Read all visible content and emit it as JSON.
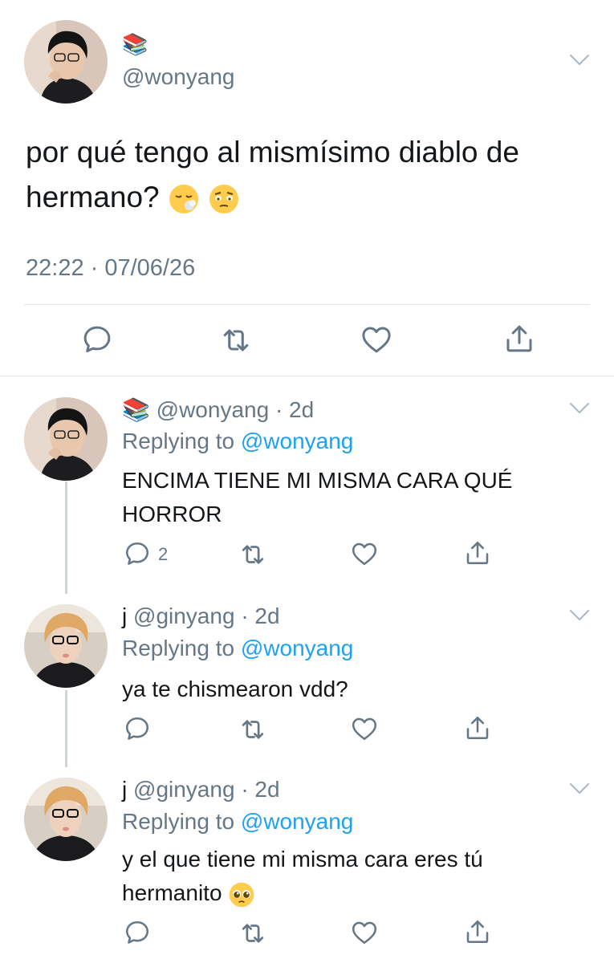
{
  "main_tweet": {
    "name_emoji": "📚",
    "handle": "@wonyang",
    "text": "por qué tengo al mismísimo diablo de hermano?",
    "timestamp": "22:22 · 07/06/26",
    "avatar": "person-avatar"
  },
  "replies": [
    {
      "name_emoji": "📚",
      "name": "",
      "handle": "@wonyang",
      "time": "· 2d",
      "replying_prefix": "Replying to ",
      "replying_to": "@wonyang",
      "text": "ENCIMA TIENE MI MISMA CARA QUÉ HORROR",
      "reply_count": "2"
    },
    {
      "name_emoji": "",
      "name": "j",
      "handle": "@ginyang",
      "time": "· 2d",
      "replying_prefix": "Replying to ",
      "replying_to": "@wonyang",
      "text": "ya te chismearon vdd?",
      "reply_count": ""
    },
    {
      "name_emoji": "",
      "name": "j",
      "handle": "@ginyang",
      "time": "· 2d",
      "replying_prefix": "Replying to ",
      "replying_to": "@wonyang",
      "text": "y el que tiene mi misma cara eres tú hermanito",
      "reply_count": ""
    }
  ],
  "icons": {
    "reply": "reply-icon",
    "retweet": "retweet-icon",
    "like": "heart-icon",
    "share": "share-icon",
    "more": "chevron-down-icon"
  },
  "colors": {
    "text": "#14171a",
    "secondary": "#657786",
    "link": "#1da1f2",
    "divider": "#e1e8ed"
  }
}
